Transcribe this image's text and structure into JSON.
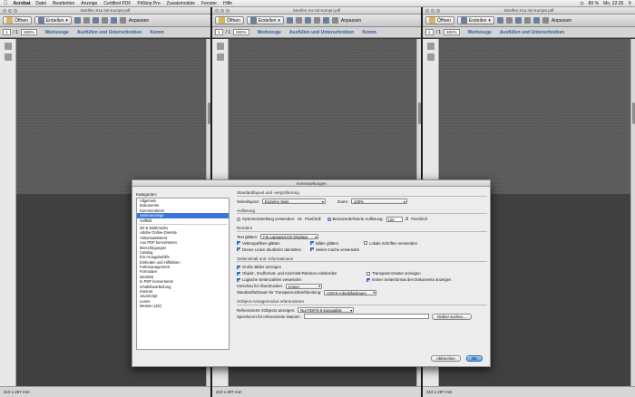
{
  "menubar": {
    "app": "Acrobat",
    "items": [
      "Datei",
      "Bearbeiten",
      "Anzeige",
      "Certified PDF",
      "PitStop Pro",
      "Zusatzmodule",
      "Fenster",
      "Hilfe"
    ],
    "status": "80 %",
    "clock": "Mo. 22:25"
  },
  "windows": [
    {
      "title": "Streifen X1a mit Kompri.pdf",
      "open": "Öffnen",
      "create": "Erstellen",
      "adjust": "Anpassen",
      "page": "1",
      "total": "/ 1",
      "zoom": "600%",
      "tools": "Werkzeuge",
      "fill": "Ausfüllen und Unterschreiben",
      "comment": "Komm",
      "size": "210 x 297 mm"
    },
    {
      "title": "Streifen X4 mit Kompri.pdf",
      "open": "Öffnen",
      "create": "Erstellen",
      "adjust": "Anpassen",
      "page": "1",
      "total": "/ 1",
      "zoom": "600%",
      "tools": "Werkzeuge",
      "fill": "Ausfüllen und Unterschreiben",
      "comment": "Komm",
      "size": "210 x 297 mm"
    },
    {
      "title": "Streifen X1a mit Kompri.pdf",
      "open": "Öffnen",
      "create": "Erstellen",
      "adjust": "Anpassen",
      "page": "1",
      "total": "/ 1",
      "zoom": "600%",
      "tools": "Werkzeuge",
      "fill": "Ausfüllen und Unterschreiben",
      "comment": "",
      "size": "210 x 297 mm"
    }
  ],
  "dialog": {
    "title": "Voreinstellungen",
    "categories_label": "Kategorien:",
    "categories_top": [
      "Allgemein",
      "Dokumente",
      "Kommentieren",
      "Seitenanzeige",
      "Vollbild"
    ],
    "categories_bottom": [
      "3D & Multimedia",
      "Adobe Online-Dienste",
      "Aktionsassistent",
      "Aus PDF konvertieren",
      "Berechtigungen",
      "Catalog",
      "Ein-/Ausgabehilfe",
      "Einheiten und Hilfslinien",
      "Farbmanagement",
      "Formulare",
      "Identität",
      "In PDF konvertieren",
      "Inhaltsbearbeitung",
      "Internet",
      "JavaScript",
      "Lesen",
      "Messen (2D)"
    ],
    "selected_category": "Seitenanzeige",
    "s1": {
      "title": "Standardlayout und -vergrößerung",
      "layout_label": "Seitenlayout:",
      "layout_value": "Einzelne Seite",
      "zoom_label": "Zoom:",
      "zoom_value": "100%"
    },
    "s2": {
      "title": "Auflösung",
      "system_label": "Systemeinstellung verwenden:",
      "system_value": "81",
      "system_unit": "Pixel/Zoll",
      "custom_label": "Benutzerdefinierte Auflösung:",
      "custom_value": "100",
      "custom_unit": "Pixel/Zoll"
    },
    "s3": {
      "title": "Rendern",
      "text_label": "Text glätten:",
      "text_value": "Für Laptops/LCD-Displays",
      "vector": "Vektorgrafiken glätten",
      "images": "Bilder glätten",
      "local_fonts": "Lokale Schriften verwenden",
      "thin_lines": "Dünne Linien deutlicher darstellen",
      "page_cache": "Seiten-Cache verwenden"
    },
    "s4": {
      "title": "Seiteninhalt und -informationen",
      "large_images": "Große Bilder anzeigen",
      "art_frames": "Objekt-, Endformat- und Anschnitt-Rahmen einblenden",
      "transparency": "Transparenzraster anzeigen",
      "logical_numbers": "Logische Seitenzahlen verwenden",
      "always_format": "Immer Seitenformat des Dokuments anzeigen",
      "overprint_label": "Vorschau für Überdrucken:",
      "overprint_value": "Immer",
      "blend_label": "Standardfarbraum für Transparenzüberblendung:",
      "blend_value": "CMYK-Arbeitsfarbraum"
    },
    "s5": {
      "title": "XObject-Ansagemodus referenzieren",
      "show_label": "Referenzierte XObjects anzeigen:",
      "show_value": "Nur PDF/X-5-kompatible",
      "path_label": "Speicherort für referenzierte Dateien:",
      "choose": "Ordner suchen..."
    },
    "cancel": "Abbrechen",
    "ok": "OK"
  }
}
